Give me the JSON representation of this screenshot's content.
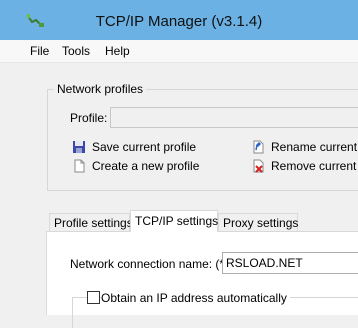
{
  "window": {
    "title": "TCP/IP Manager (v3.1.4)"
  },
  "menu": {
    "file": "File",
    "tools": "Tools",
    "help": "Help"
  },
  "profiles": {
    "group_title": "Network profiles",
    "profile_label": "Profile:",
    "profile_value": "",
    "save": "Save current profile",
    "create": "Create a new profile",
    "rename": "Rename current p",
    "remove": "Remove current p"
  },
  "tabs": [
    "Profile settings",
    "TCP/IP settings",
    "Proxy settings"
  ],
  "tcpip": {
    "connection_label": "Network connection name: (*)",
    "connection_value": "RSLOAD.NET",
    "auto_ip_label": "Obtain an IP address automatically",
    "auto_ip_checked": false
  },
  "colors": {
    "titlebar": "#6cb1e3",
    "background": "#f0f0f0"
  },
  "icons": {
    "app": "network-plug-icon",
    "save": "floppy-disk-icon",
    "new": "blank-page-icon",
    "rename": "rename-icon",
    "remove": "delete-document-icon"
  }
}
